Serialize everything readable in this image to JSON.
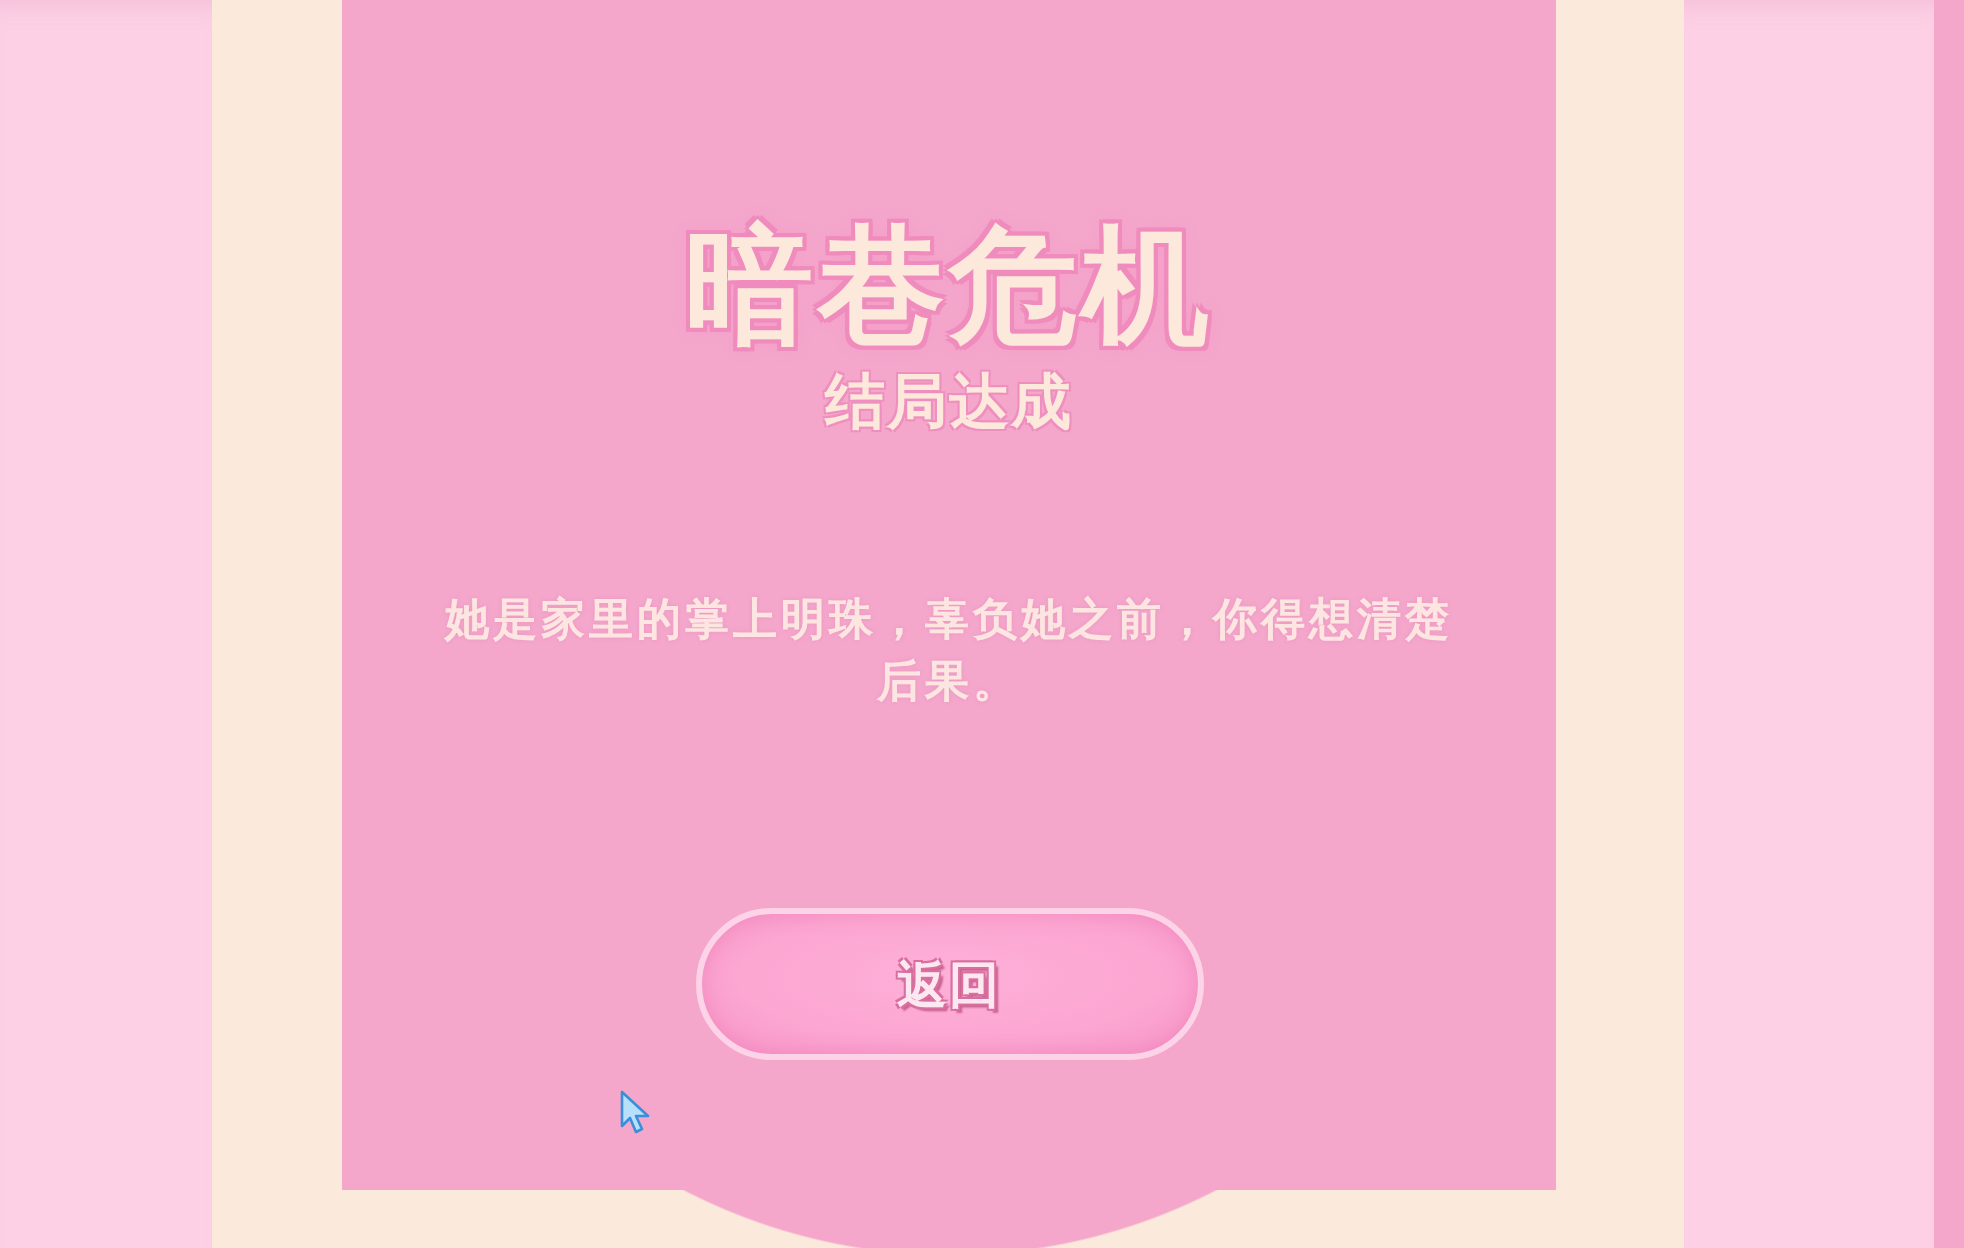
{
  "ending": {
    "title": "暗巷危机",
    "subtitle": "结局达成",
    "message": "她是家里的掌上明珠，辜负她之前，你得想清楚后果。",
    "button": {
      "label": "返回"
    }
  }
}
